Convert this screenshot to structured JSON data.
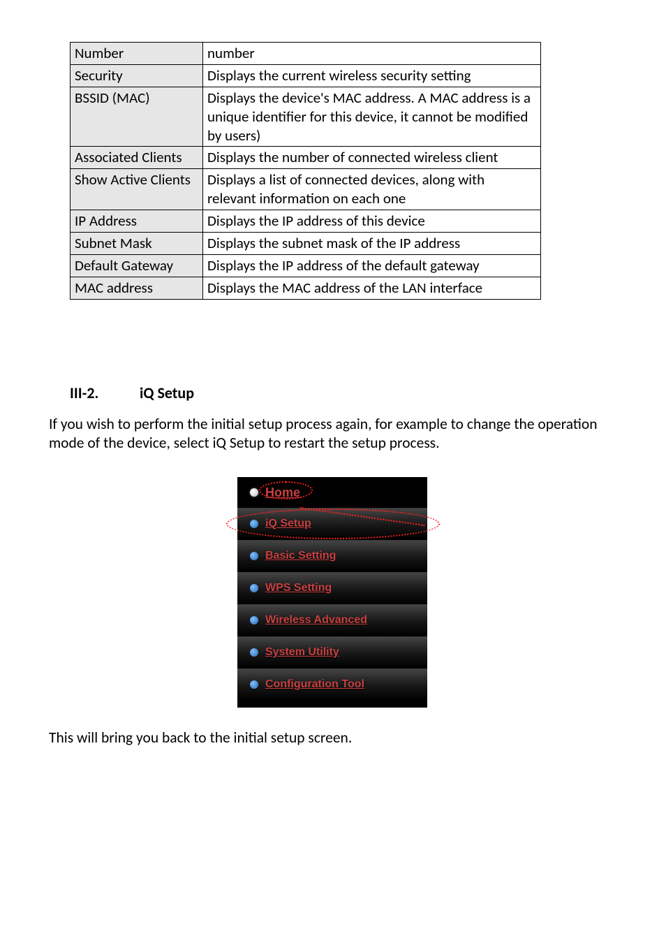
{
  "table": {
    "rows": [
      {
        "label": "Number",
        "value": "number"
      },
      {
        "label": "Security",
        "value": "Displays the current wireless security setting"
      },
      {
        "label": "BSSID (MAC)",
        "value": "Displays the device's MAC address. A MAC address is a unique identifier for this device, it cannot be modified by users)"
      },
      {
        "label": "Associated Clients",
        "value": "Displays the number of connected wireless client"
      },
      {
        "label": "Show Active Clients",
        "value": "Displays a list of connected devices, along with relevant information on each one"
      },
      {
        "label": "IP Address",
        "value": "Displays the IP address of this device"
      },
      {
        "label": "Subnet Mask",
        "value": "Displays the subnet mask of the IP address"
      },
      {
        "label": "Default Gateway",
        "value": "Displays the IP address of the default gateway"
      },
      {
        "label": "MAC address",
        "value": "Displays the MAC address of the LAN interface"
      }
    ]
  },
  "heading": {
    "num": "III-2.",
    "title": "iQ Setup"
  },
  "para1": "If you wish to perform the initial setup process again, for example to change the operation mode of the device, select iQ Setup to restart the setup process.",
  "menu": {
    "home": "Home",
    "iq": "iQ Setup",
    "basic": "Basic Setting",
    "wps": "WPS Setting",
    "wireless": "Wireless Advanced",
    "system": "System Utility",
    "config": "Configuration Tool"
  },
  "para2": "This will bring you back to the initial setup screen."
}
